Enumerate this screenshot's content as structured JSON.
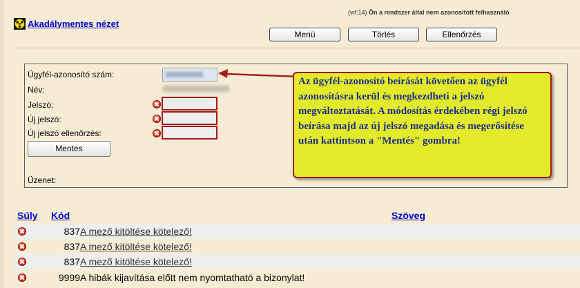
{
  "header": {
    "workflow_id": "(wf:14)",
    "user_status": "Ön a rendszer által nem azonosított felhasználó",
    "accessible_view_label": "Akadálymentes nézet"
  },
  "toolbar": {
    "menu_label": "Menü",
    "clear_label": "Törlés",
    "check_label": "Ellenőrzés"
  },
  "form": {
    "client_id_label": "Ügyfél-azonosító szám:",
    "client_id_value": "",
    "name_label": "Név:",
    "name_value": "",
    "password_label": "Jelszó:",
    "new_password_label": "Új jelszó:",
    "confirm_password_label": "Új jelszó ellenőrzés:",
    "save_label": "Mentes",
    "message_label": "Üzenet:"
  },
  "callout": {
    "text": "Az ügyfél-azonosító beírását követően az ügyfél azonosításra kerül és megkezdheti a jelszó megváltoztatását. A módosítás érdekében régi jelszó beírása majd az új jelszó megadása és megerősítése után kattintson a \"Mentés\" gombra!",
    "background_color": "#e2ea2a",
    "border_color": "#9c1d14",
    "text_color": "#1f2f8a"
  },
  "errors_table": {
    "headers": {
      "severity": "Súly",
      "code": "Kód",
      "text": "Szöveg"
    },
    "rows": [
      {
        "code": "837",
        "text": "A mező kitöltése kötelező!",
        "icon": "error-icon"
      },
      {
        "code": "837",
        "text": "A mező kitöltése kötelező!",
        "icon": "error-icon"
      },
      {
        "code": "837",
        "text": "A mező kitöltése kötelező!",
        "icon": "error-icon"
      },
      {
        "code": "9999",
        "text": "A hibák kijavítása előtt nem nyomtatható a bizonylat!",
        "icon": "error-icon"
      }
    ]
  },
  "colors": {
    "page_background": "#f6ecd6",
    "link": "#0000cc",
    "error_border": "#a21b1b"
  }
}
